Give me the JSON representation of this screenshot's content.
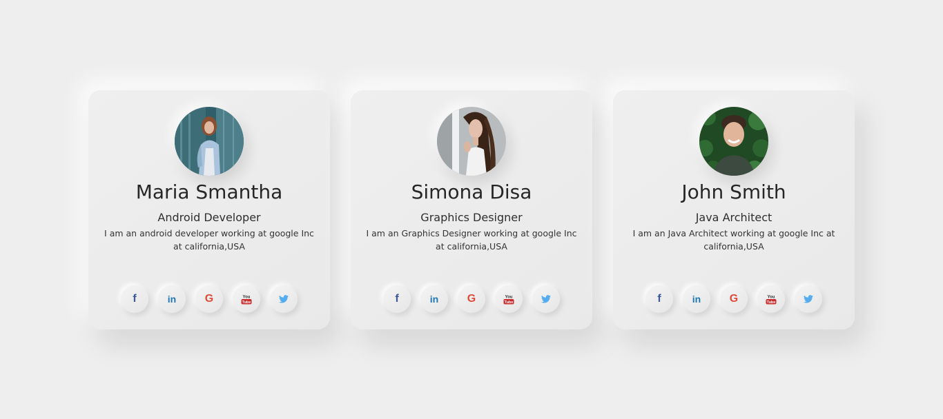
{
  "profiles": [
    {
      "name": "Maria Smantha",
      "role": "Android Developer",
      "description": "I am an android developer working at google Inc at california,USA"
    },
    {
      "name": "Simona Disa",
      "role": "Graphics Designer",
      "description": "I am an Graphics Designer working at google Inc at california,USA"
    },
    {
      "name": "John Smith",
      "role": "Java Architect",
      "description": "I am an Java Architect working at google Inc at california,USA"
    }
  ],
  "social": {
    "facebook": "f",
    "linkedin": "in",
    "google": "G",
    "youtube_top": "You",
    "youtube_bottom": "Tube"
  },
  "icons": [
    "facebook-icon",
    "linkedin-icon",
    "google-icon",
    "youtube-icon",
    "twitter-icon"
  ],
  "colors": {
    "background": "#eeeeee",
    "facebook": "#3b5998",
    "linkedin": "#1f78b4",
    "google": "#dd4b39",
    "youtube": "#cc2a2a",
    "twitter": "#55acee"
  }
}
